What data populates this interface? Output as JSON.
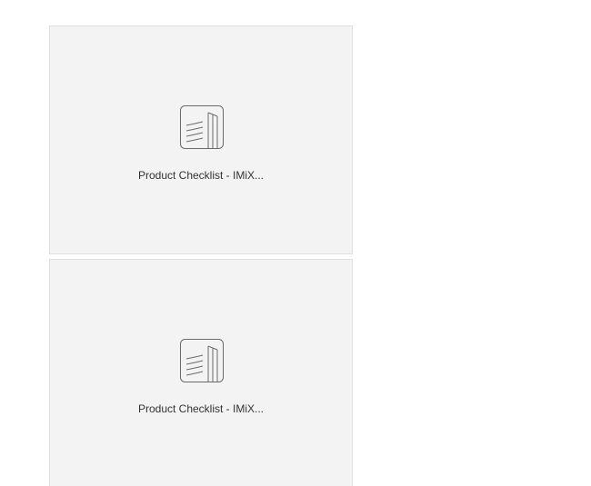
{
  "cards": [
    {
      "title": "Product Checklist - IMiX...",
      "icon": "document-pages-icon"
    },
    {
      "title": "Product Checklist - IMiX...",
      "icon": "document-pages-icon"
    }
  ],
  "colors": {
    "card_background": "#f3f3f3",
    "card_border": "#e1e1e1",
    "icon_stroke": "#6b6b6b",
    "label_text": "#333333"
  }
}
